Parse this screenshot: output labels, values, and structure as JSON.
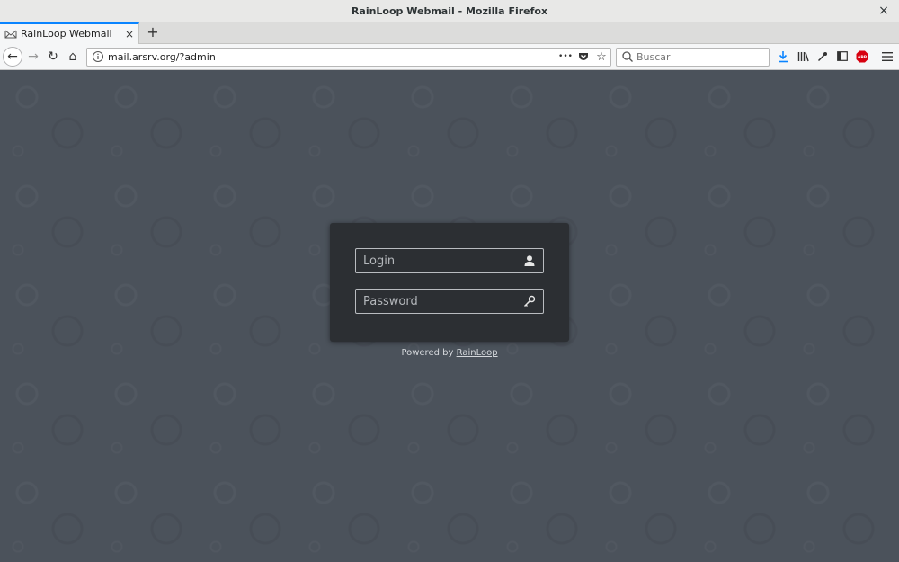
{
  "window": {
    "title": "RainLoop Webmail - Mozilla Firefox",
    "close_glyph": "×"
  },
  "tabs": [
    {
      "label": "RainLoop Webmail",
      "close_glyph": "×",
      "icon": "rainloop-favicon"
    }
  ],
  "new_tab_glyph": "+",
  "nav": {
    "back_glyph": "←",
    "forward_glyph": "→",
    "reload_glyph": "↻",
    "home_glyph": "⌂",
    "url": "mail.arsrv.org/?admin",
    "page_actions_glyph": "•••",
    "search_placeholder": "Buscar"
  },
  "toolbar_icons": [
    "download-icon",
    "library-icon",
    "eyedropper-icon",
    "sidebar-icon",
    "abp-icon",
    "menu-icon"
  ],
  "login": {
    "login_placeholder": "Login",
    "password_placeholder": "Password",
    "powered_prefix": "Powered by",
    "powered_link": "RainLoop"
  },
  "colors": {
    "page_bg": "#4b525b",
    "panel_bg": "#2c2f33",
    "tab_accent": "#0a84ff",
    "download_blue": "#0a84ff",
    "abp_red": "#d7000f"
  }
}
